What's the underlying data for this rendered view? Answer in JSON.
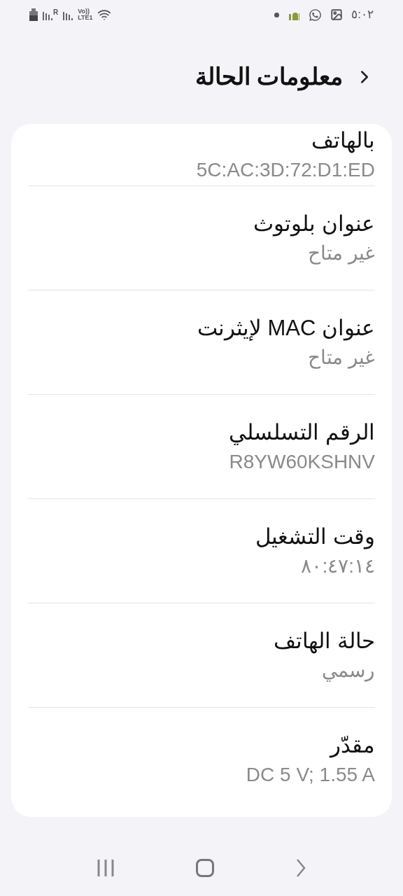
{
  "status_bar": {
    "time": "٥:٠٢",
    "roaming": "R",
    "volte": "Vo))",
    "lte": "LTE1"
  },
  "header": {
    "title": "معلومات الحالة"
  },
  "items": [
    {
      "label": "بالهاتف",
      "value": "5C:AC:3D:72:D1:ED"
    },
    {
      "label": "عنوان بلوتوث",
      "value": "غير متاح"
    },
    {
      "label": "عنوان MAC لإيثرنت",
      "value": "غير متاح"
    },
    {
      "label": "الرقم التسلسلي",
      "value": "R8YW60KSHNV"
    },
    {
      "label": "وقت التشغيل",
      "value": "٨٠:٤٧:١٤"
    },
    {
      "label": "حالة الهاتف",
      "value": "رسمي"
    },
    {
      "label": "مقدّر",
      "value": "DC 5 V; 1.55 A"
    }
  ]
}
